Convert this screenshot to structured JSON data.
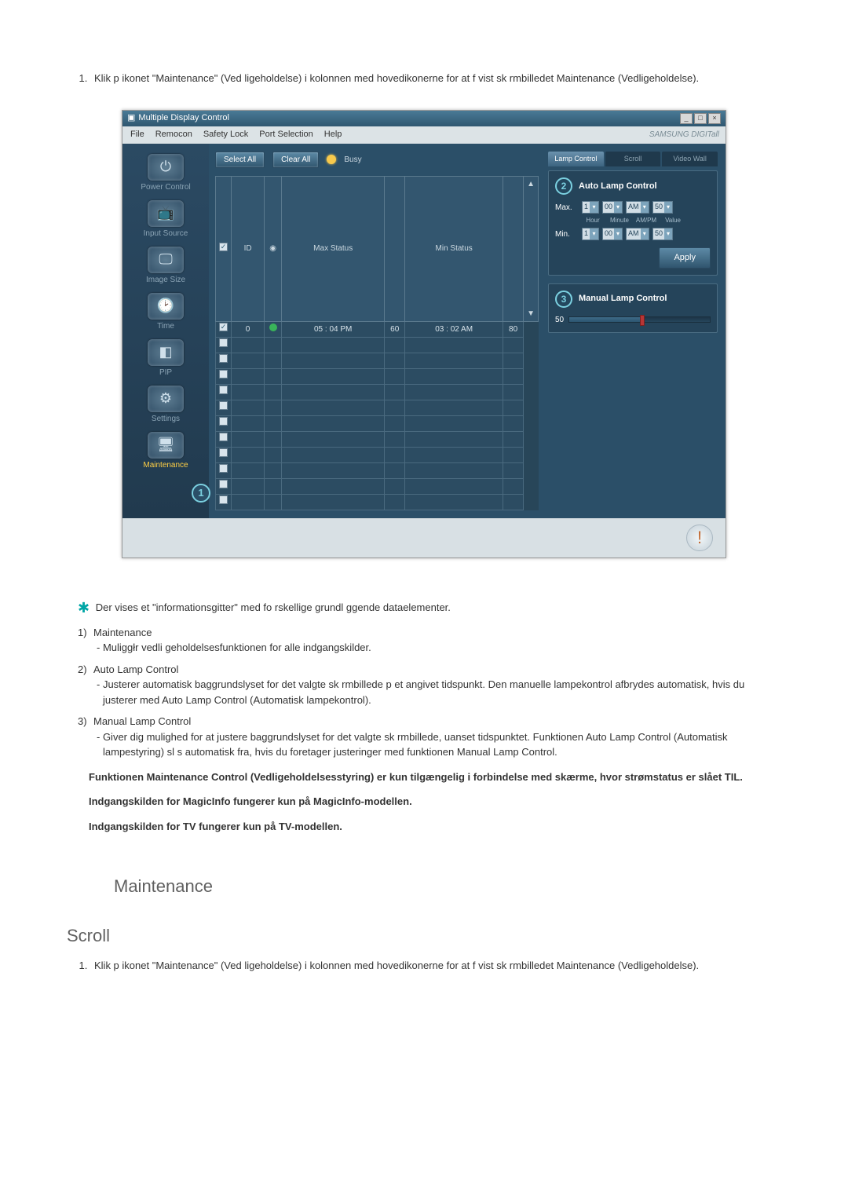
{
  "intro": {
    "step1": "Klik p  ikonet \"Maintenance\" (Ved ligeholdelse) i kolonnen med hovedikonerne for at f  vist sk rmbilledet Maintenance (Vedligeholdelse)."
  },
  "app": {
    "title": "Multiple Display Control",
    "menu": [
      "File",
      "Remocon",
      "Safety Lock",
      "Port Selection",
      "Help"
    ],
    "brand": "SAMSUNG DIGITall",
    "toolbar": {
      "select_all": "Select All",
      "clear_all": "Clear All",
      "busy": "Busy"
    },
    "sidebar": {
      "items": [
        {
          "label": "Power Control",
          "glyph": "⏻"
        },
        {
          "label": "Input Source",
          "glyph": "📺"
        },
        {
          "label": "Image Size",
          "glyph": "🖵"
        },
        {
          "label": "Time",
          "glyph": "🕑"
        },
        {
          "label": "PIP",
          "glyph": "◧"
        },
        {
          "label": "Settings",
          "glyph": "⚙"
        },
        {
          "label": "Maintenance",
          "glyph": "🖥"
        }
      ],
      "badge": "1"
    },
    "grid": {
      "headers": {
        "id": "ID",
        "status_icon": "",
        "max_status": "Max Status",
        "max_val": "",
        "min_status": "Min Status",
        "min_val": ""
      },
      "row": {
        "checked": true,
        "id": "0",
        "status": "on",
        "max_status": "05 : 04 PM",
        "max_val": "60",
        "min_status": "03 : 02 AM",
        "min_val": "80"
      }
    },
    "tabs": {
      "lamp": "Lamp Control",
      "scroll": "Scroll",
      "video": "Video Wall"
    },
    "auto": {
      "title": "Auto Lamp Control",
      "badge": "2",
      "max_label": "Max.",
      "min_label": "Min.",
      "sub": {
        "hour": "Hour",
        "minute": "Minute",
        "ampm": "AM/PM",
        "value": "Value"
      },
      "max": {
        "hour": "1",
        "minute": "00",
        "ampm": "AM",
        "value": "50"
      },
      "min": {
        "hour": "1",
        "minute": "00",
        "ampm": "AM",
        "value": "50"
      },
      "apply": "Apply"
    },
    "manual": {
      "title": "Manual Lamp Control",
      "badge": "3",
      "value": "50"
    }
  },
  "below": {
    "star_line": "Der vises et \"informationsgitter\" med fo rskellige grundl ggende dataelementer.",
    "items": [
      {
        "num": "1)",
        "name": "Maintenance",
        "desc": "- Muliggłr vedli geholdelsesfunktionen for alle indgangskilder."
      },
      {
        "num": "2)",
        "name": "Auto Lamp Control",
        "desc": "- Justerer automatisk baggrundslyset for det valgte sk rmbillede p  et angivet tidspunkt. Den manuelle lampekontrol afbrydes automatisk, hvis du justerer med Auto Lamp Control (Automatisk lampekontrol)."
      },
      {
        "num": "3)",
        "name": "Manual Lamp Control",
        "desc": "- Giver dig mulighed for at justere baggrundslyset for det valgte sk rmbillede, uanset tidspunktet. Funktionen Auto Lamp Control (Automatisk lampestyring) sl s automatisk fra, hvis du foretager justeringer med funktionen Manual Lamp Control."
      }
    ],
    "bold1": "Funktionen Maintenance Control (Vedligeholdelsesstyring) er kun tilgængelig i forbindelse med skærme, hvor strømstatus er slået TIL.",
    "bold2": "Indgangskilden for MagicInfo fungerer kun på MagicInfo-modellen.",
    "bold3": "Indgangskilden for TV fungerer kun på TV-modellen."
  },
  "headings": {
    "maintenance": "Maintenance",
    "scroll": "Scroll"
  },
  "intro2": {
    "step1": "Klik p  ikonet \"Maintenance\" (Ved ligeholdelse) i kolonnen med hovedikonerne for at f  vist sk rmbilledet Maintenance (Vedligeholdelse)."
  }
}
